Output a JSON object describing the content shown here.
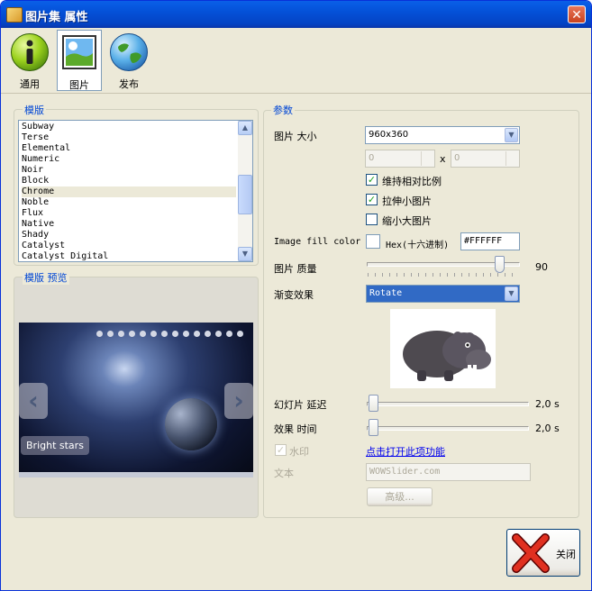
{
  "window": {
    "title": "图片集 属性",
    "close_glyph": "✕"
  },
  "toolbar": {
    "items": [
      {
        "label": "通用",
        "icon": "info-icon"
      },
      {
        "label": "图片",
        "icon": "image-icon",
        "active": true
      },
      {
        "label": "发布",
        "icon": "globe-icon"
      }
    ]
  },
  "template": {
    "legend": "模版",
    "items": [
      "Subway",
      "Terse",
      "Elemental",
      "Numeric",
      "Noir",
      "Block",
      "Chrome",
      "Noble",
      "Flux",
      "Native",
      "Shady",
      "Catalyst",
      "Catalyst Digital"
    ],
    "selected": "Chrome"
  },
  "preview": {
    "legend": "模版 预览",
    "caption": "Bright stars",
    "prev_glyph": "‹",
    "next_glyph": "›"
  },
  "params": {
    "legend": "参数",
    "size_label": "图片 大小",
    "size_value": "960x360",
    "width_value": "0",
    "height_value": "0",
    "x_sep": "x",
    "keep_ratio_label": "维持相对比例",
    "keep_ratio": true,
    "stretch_label": "拉伸小图片",
    "stretch": true,
    "shrink_label": "缩小大图片",
    "shrink": false,
    "fill_color_label": "Image fill color",
    "hex_label": "Hex(十六进制)",
    "hex_value": "#FFFFFF",
    "quality_label": "图片 质量",
    "quality_value": "90",
    "quality_fraction": 0.9,
    "transition_label": "渐变效果",
    "transition_value": "Rotate",
    "slide_delay_label": "幻灯片 延迟",
    "slide_delay_value": "2,0 s",
    "effect_time_label": "效果 时间",
    "effect_time_value": "2,0 s",
    "watermark_label": "水印",
    "watermark": true,
    "watermark_link": "点击打开此项功能",
    "text_label": "文本",
    "text_value": "WOWSlider.com",
    "advanced_label": "高级..."
  },
  "footer": {
    "close_label": "关闭"
  },
  "colors": {
    "title_bar": "#0451d8",
    "legend_text": "#0046d5",
    "selection": "#316ac5"
  }
}
